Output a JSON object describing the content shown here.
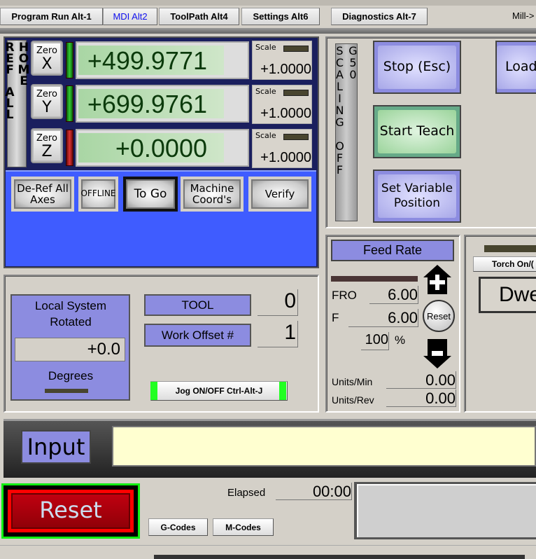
{
  "tabs": [
    {
      "label": "Program Run Alt-1",
      "active": false
    },
    {
      "label": "MDI Alt2",
      "active": true
    },
    {
      "label": "ToolPath Alt4",
      "active": false
    },
    {
      "label": "Settings Alt6",
      "active": false
    },
    {
      "label": "Diagnostics Alt-7",
      "active": false
    }
  ],
  "mode_label": "Mill->",
  "dro": {
    "ref_all_home": "REF ALL HOME",
    "axes": [
      {
        "zero_label": "Zero",
        "axis": "X",
        "value": "+499.9771",
        "scale_label": "Scale",
        "scale": "+1.0000",
        "led": "green"
      },
      {
        "zero_label": "Zero",
        "axis": "Y",
        "value": "+699.9761",
        "scale_label": "Scale",
        "scale": "+1.0000",
        "led": "green"
      },
      {
        "zero_label": "Zero",
        "axis": "Z",
        "value": "+0.0000",
        "scale_label": "Scale",
        "scale": "+1.0000",
        "led": "red"
      }
    ],
    "buttons": {
      "deref": "De-Ref All Axes",
      "offline": "OFFLINE",
      "togo": "To Go",
      "machine": "Machine Coord's",
      "verify": "Verify"
    }
  },
  "scaling": "SCALING OFF G50",
  "actions": {
    "stop": "Stop (Esc)",
    "teach": "Start Teach",
    "setvar": "Set Variable Position",
    "load": "Load"
  },
  "local": {
    "title": "Local System Rotated",
    "value": "+0.0",
    "units": "Degrees",
    "tool_label": "TOOL",
    "tool": "0",
    "offset_label": "Work Offset #",
    "offset": "1",
    "jog": "Jog ON/OFF Ctrl-Alt-J"
  },
  "feed": {
    "title": "Feed Rate",
    "fro_label": "FRO",
    "fro": "6.00",
    "f_label": "F",
    "f": "6.00",
    "percent": "100",
    "percent_sign": "%",
    "reset": "Reset",
    "units_min_label": "Units/Min",
    "units_min": "0.00",
    "units_rev_label": "Units/Rev",
    "units_rev": "0.00"
  },
  "torch": {
    "label": "Torch On/(",
    "dwell": "Dwe"
  },
  "input": {
    "label": "Input",
    "value": ""
  },
  "bottom": {
    "reset": "Reset",
    "elapsed_label": "Elapsed",
    "elapsed": "00:00",
    "gcodes": "G-Codes",
    "mcodes": "M-Codes"
  },
  "colors": {
    "dro_bg": "#1a1f5e",
    "blue": "#3f5cff",
    "reset_red": "#a80008",
    "input_bg": "#ffffd0",
    "button_purple": "#8c8ce0"
  }
}
